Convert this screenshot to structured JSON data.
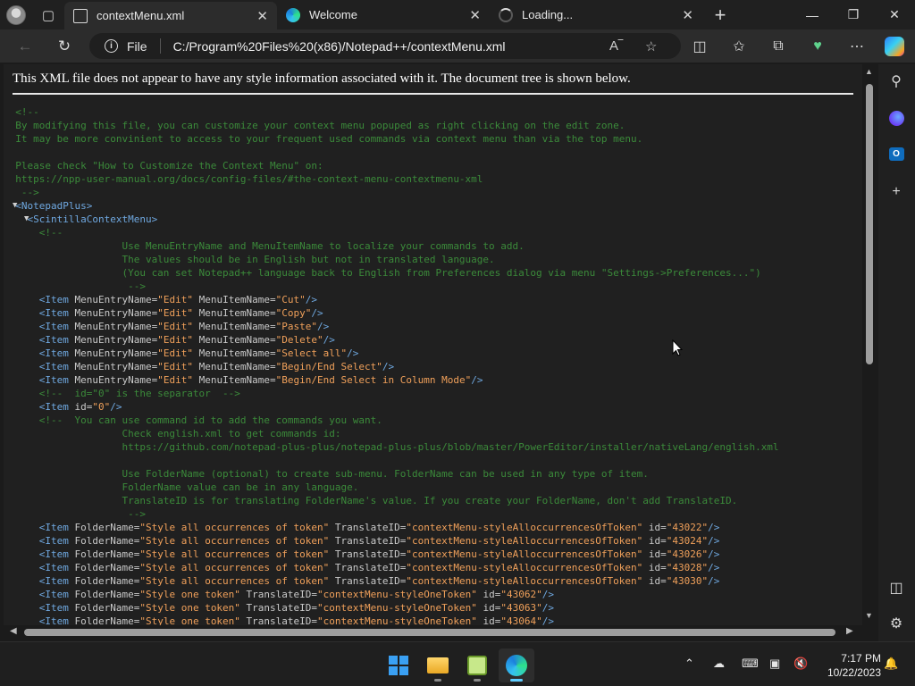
{
  "tabs": [
    {
      "title": "contextMenu.xml"
    },
    {
      "title": "Welcome"
    },
    {
      "title": "Loading..."
    }
  ],
  "address": {
    "scheme_label": "File",
    "url": "C:/Program%20Files%20(x86)/Notepad++/contextMenu.xml"
  },
  "notice": "This XML file does not appear to have any style information associated with it. The document tree is shown below.",
  "xml_lines": [
    [
      {
        "c": "cm",
        "t": "  <!--"
      }
    ],
    [
      {
        "c": "cm",
        "t": "  By modifying this file, you can customize your context menu popuped as right clicking on the edit zone."
      }
    ],
    [
      {
        "c": "cm",
        "t": "  It may be more convinient to access to your frequent used commands via context menu than via the top menu."
      }
    ],
    [
      {
        "c": "cm",
        "t": ""
      }
    ],
    [
      {
        "c": "cm",
        "t": "  Please check \"How to Customize the Context Menu\" on:"
      }
    ],
    [
      {
        "c": "cm",
        "t": "  https://npp-user-manual.org/docs/config-files/#the-context-menu-contextmenu-xml"
      }
    ],
    [
      {
        "c": "cm",
        "t": "   -->"
      }
    ],
    [
      {
        "c": "tg",
        "t": "  <NotepadPlus>"
      }
    ],
    [
      {
        "c": "tg",
        "t": "    <ScintillaContextMenu>"
      }
    ],
    [
      {
        "c": "cm",
        "t": "      <!--"
      }
    ],
    [
      {
        "c": "cm",
        "t": "                    Use MenuEntryName and MenuItemName to localize your commands to add."
      }
    ],
    [
      {
        "c": "cm",
        "t": "                    The values should be in English but not in translated language."
      }
    ],
    [
      {
        "c": "cm",
        "t": "                    (You can set Notepad++ language back to English from Preferences dialog via menu \"Settings->Preferences...\")"
      }
    ],
    [
      {
        "c": "cm",
        "t": "                     -->"
      }
    ],
    [
      {
        "c": "tg",
        "t": "      <Item "
      },
      {
        "c": "at",
        "t": "MenuEntryName="
      },
      {
        "c": "vl",
        "t": "\"Edit\""
      },
      {
        "c": "at",
        "t": " MenuItemName="
      },
      {
        "c": "vl",
        "t": "\"Cut\""
      },
      {
        "c": "tg",
        "t": "/>"
      }
    ],
    [
      {
        "c": "tg",
        "t": "      <Item "
      },
      {
        "c": "at",
        "t": "MenuEntryName="
      },
      {
        "c": "vl",
        "t": "\"Edit\""
      },
      {
        "c": "at",
        "t": " MenuItemName="
      },
      {
        "c": "vl",
        "t": "\"Copy\""
      },
      {
        "c": "tg",
        "t": "/>"
      }
    ],
    [
      {
        "c": "tg",
        "t": "      <Item "
      },
      {
        "c": "at",
        "t": "MenuEntryName="
      },
      {
        "c": "vl",
        "t": "\"Edit\""
      },
      {
        "c": "at",
        "t": " MenuItemName="
      },
      {
        "c": "vl",
        "t": "\"Paste\""
      },
      {
        "c": "tg",
        "t": "/>"
      }
    ],
    [
      {
        "c": "tg",
        "t": "      <Item "
      },
      {
        "c": "at",
        "t": "MenuEntryName="
      },
      {
        "c": "vl",
        "t": "\"Edit\""
      },
      {
        "c": "at",
        "t": " MenuItemName="
      },
      {
        "c": "vl",
        "t": "\"Delete\""
      },
      {
        "c": "tg",
        "t": "/>"
      }
    ],
    [
      {
        "c": "tg",
        "t": "      <Item "
      },
      {
        "c": "at",
        "t": "MenuEntryName="
      },
      {
        "c": "vl",
        "t": "\"Edit\""
      },
      {
        "c": "at",
        "t": " MenuItemName="
      },
      {
        "c": "vl",
        "t": "\"Select all\""
      },
      {
        "c": "tg",
        "t": "/>"
      }
    ],
    [
      {
        "c": "tg",
        "t": "      <Item "
      },
      {
        "c": "at",
        "t": "MenuEntryName="
      },
      {
        "c": "vl",
        "t": "\"Edit\""
      },
      {
        "c": "at",
        "t": " MenuItemName="
      },
      {
        "c": "vl",
        "t": "\"Begin/End Select\""
      },
      {
        "c": "tg",
        "t": "/>"
      }
    ],
    [
      {
        "c": "tg",
        "t": "      <Item "
      },
      {
        "c": "at",
        "t": "MenuEntryName="
      },
      {
        "c": "vl",
        "t": "\"Edit\""
      },
      {
        "c": "at",
        "t": " MenuItemName="
      },
      {
        "c": "vl",
        "t": "\"Begin/End Select in Column Mode\""
      },
      {
        "c": "tg",
        "t": "/>"
      }
    ],
    [
      {
        "c": "cm",
        "t": "      <!--  id=\"0\" is the separator  -->"
      }
    ],
    [
      {
        "c": "tg",
        "t": "      <Item "
      },
      {
        "c": "at",
        "t": "id="
      },
      {
        "c": "vl",
        "t": "\"0\""
      },
      {
        "c": "tg",
        "t": "/>"
      }
    ],
    [
      {
        "c": "cm",
        "t": "      <!--  You can use command id to add the commands you want."
      }
    ],
    [
      {
        "c": "cm",
        "t": "                    Check english.xml to get commands id:"
      }
    ],
    [
      {
        "c": "cm",
        "t": "                    https://github.com/notepad-plus-plus/notepad-plus-plus/blob/master/PowerEditor/installer/nativeLang/english.xml"
      }
    ],
    [
      {
        "c": "cm",
        "t": ""
      }
    ],
    [
      {
        "c": "cm",
        "t": "                    Use FolderName (optional) to create sub-menu. FolderName can be used in any type of item."
      }
    ],
    [
      {
        "c": "cm",
        "t": "                    FolderName value can be in any language."
      }
    ],
    [
      {
        "c": "cm",
        "t": "                    TranslateID is for translating FolderName's value. If you create your FolderName, don't add TranslateID."
      }
    ],
    [
      {
        "c": "cm",
        "t": "                     -->"
      }
    ],
    [
      {
        "c": "tg",
        "t": "      <Item "
      },
      {
        "c": "at",
        "t": "FolderName="
      },
      {
        "c": "vl",
        "t": "\"Style all occurrences of token\""
      },
      {
        "c": "at",
        "t": " TranslateID="
      },
      {
        "c": "vl",
        "t": "\"contextMenu-styleAlloccurrencesOfToken\""
      },
      {
        "c": "at",
        "t": " id="
      },
      {
        "c": "vl",
        "t": "\"43022\""
      },
      {
        "c": "tg",
        "t": "/>"
      }
    ],
    [
      {
        "c": "tg",
        "t": "      <Item "
      },
      {
        "c": "at",
        "t": "FolderName="
      },
      {
        "c": "vl",
        "t": "\"Style all occurrences of token\""
      },
      {
        "c": "at",
        "t": " TranslateID="
      },
      {
        "c": "vl",
        "t": "\"contextMenu-styleAlloccurrencesOfToken\""
      },
      {
        "c": "at",
        "t": " id="
      },
      {
        "c": "vl",
        "t": "\"43024\""
      },
      {
        "c": "tg",
        "t": "/>"
      }
    ],
    [
      {
        "c": "tg",
        "t": "      <Item "
      },
      {
        "c": "at",
        "t": "FolderName="
      },
      {
        "c": "vl",
        "t": "\"Style all occurrences of token\""
      },
      {
        "c": "at",
        "t": " TranslateID="
      },
      {
        "c": "vl",
        "t": "\"contextMenu-styleAlloccurrencesOfToken\""
      },
      {
        "c": "at",
        "t": " id="
      },
      {
        "c": "vl",
        "t": "\"43026\""
      },
      {
        "c": "tg",
        "t": "/>"
      }
    ],
    [
      {
        "c": "tg",
        "t": "      <Item "
      },
      {
        "c": "at",
        "t": "FolderName="
      },
      {
        "c": "vl",
        "t": "\"Style all occurrences of token\""
      },
      {
        "c": "at",
        "t": " TranslateID="
      },
      {
        "c": "vl",
        "t": "\"contextMenu-styleAlloccurrencesOfToken\""
      },
      {
        "c": "at",
        "t": " id="
      },
      {
        "c": "vl",
        "t": "\"43028\""
      },
      {
        "c": "tg",
        "t": "/>"
      }
    ],
    [
      {
        "c": "tg",
        "t": "      <Item "
      },
      {
        "c": "at",
        "t": "FolderName="
      },
      {
        "c": "vl",
        "t": "\"Style all occurrences of token\""
      },
      {
        "c": "at",
        "t": " TranslateID="
      },
      {
        "c": "vl",
        "t": "\"contextMenu-styleAlloccurrencesOfToken\""
      },
      {
        "c": "at",
        "t": " id="
      },
      {
        "c": "vl",
        "t": "\"43030\""
      },
      {
        "c": "tg",
        "t": "/>"
      }
    ],
    [
      {
        "c": "tg",
        "t": "      <Item "
      },
      {
        "c": "at",
        "t": "FolderName="
      },
      {
        "c": "vl",
        "t": "\"Style one token\""
      },
      {
        "c": "at",
        "t": " TranslateID="
      },
      {
        "c": "vl",
        "t": "\"contextMenu-styleOneToken\""
      },
      {
        "c": "at",
        "t": " id="
      },
      {
        "c": "vl",
        "t": "\"43062\""
      },
      {
        "c": "tg",
        "t": "/>"
      }
    ],
    [
      {
        "c": "tg",
        "t": "      <Item "
      },
      {
        "c": "at",
        "t": "FolderName="
      },
      {
        "c": "vl",
        "t": "\"Style one token\""
      },
      {
        "c": "at",
        "t": " TranslateID="
      },
      {
        "c": "vl",
        "t": "\"contextMenu-styleOneToken\""
      },
      {
        "c": "at",
        "t": " id="
      },
      {
        "c": "vl",
        "t": "\"43063\""
      },
      {
        "c": "tg",
        "t": "/>"
      }
    ],
    [
      {
        "c": "tg",
        "t": "      <Item "
      },
      {
        "c": "at",
        "t": "FolderName="
      },
      {
        "c": "vl",
        "t": "\"Style one token\""
      },
      {
        "c": "at",
        "t": " TranslateID="
      },
      {
        "c": "vl",
        "t": "\"contextMenu-styleOneToken\""
      },
      {
        "c": "at",
        "t": " id="
      },
      {
        "c": "vl",
        "t": "\"43064\""
      },
      {
        "c": "tg",
        "t": "/>"
      }
    ]
  ],
  "colors": {
    "comment": "#3b8a3a",
    "tag": "#6fa8e0",
    "attribute": "#c9c9c9",
    "value": "#f0a05a",
    "accent": "#60cdff"
  },
  "clock": {
    "time": "7:17 PM",
    "date": "10/22/2023"
  },
  "taskbar_apps": [
    "start-icon",
    "file-explorer-icon",
    "notepad-plus-plus-icon",
    "edge-icon"
  ]
}
